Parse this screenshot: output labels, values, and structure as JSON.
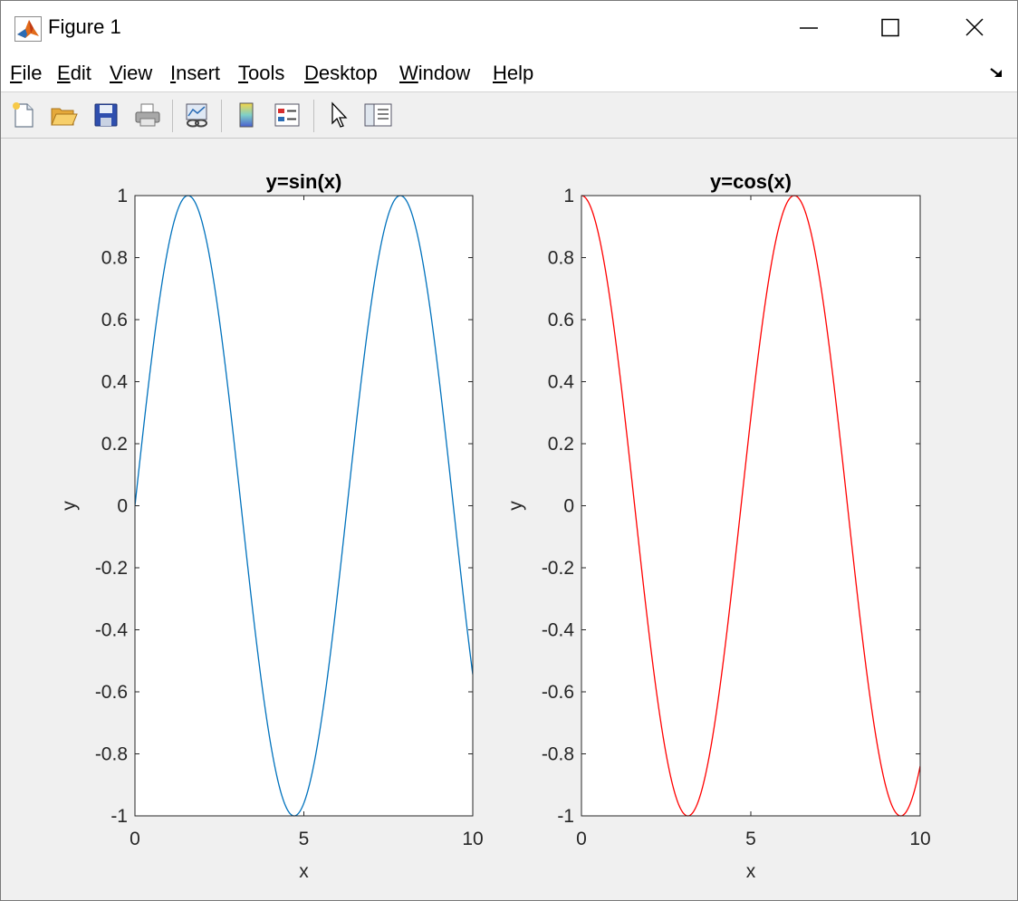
{
  "window": {
    "title": "Figure 1",
    "icons": {
      "app": "matlab-logo-icon",
      "minimize": "minimize-icon",
      "maximize": "maximize-icon",
      "close": "close-icon"
    }
  },
  "menubar": {
    "items": [
      {
        "label": "File",
        "accel": "F",
        "rest": "ile"
      },
      {
        "label": "Edit",
        "accel": "E",
        "rest": "dit"
      },
      {
        "label": "View",
        "accel": "V",
        "rest": "iew"
      },
      {
        "label": "Insert",
        "accel": "I",
        "rest": "nsert"
      },
      {
        "label": "Tools",
        "accel": "T",
        "rest": "ools"
      },
      {
        "label": "Desktop",
        "accel": "D",
        "rest": "esktop"
      },
      {
        "label": "Window",
        "accel": "W",
        "rest": "indow"
      },
      {
        "label": "Help",
        "accel": "H",
        "rest": "elp"
      }
    ],
    "dock_icon": "dock-arrow-icon"
  },
  "toolbar": {
    "buttons": [
      {
        "name": "new-figure",
        "icon": "new-file-icon"
      },
      {
        "name": "open-file",
        "icon": "folder-open-icon"
      },
      {
        "name": "save-figure",
        "icon": "floppy-disk-icon"
      },
      {
        "name": "print-figure",
        "icon": "printer-icon"
      },
      {
        "name": "link-plot",
        "icon": "link-plot-icon"
      },
      {
        "name": "insert-colorbar",
        "icon": "colorbar-icon"
      },
      {
        "name": "insert-legend",
        "icon": "legend-icon"
      },
      {
        "name": "edit-plot",
        "icon": "pointer-arrow-icon"
      },
      {
        "name": "show-plot-tools",
        "icon": "plot-tools-icon"
      }
    ]
  },
  "colors": {
    "sin_line": "#0072bd",
    "cos_line": "#ff0000",
    "axes_bg": "#ffffff",
    "figure_bg": "#f0f0f0",
    "axis_color": "#262626"
  },
  "chart_data": [
    {
      "type": "line",
      "title": "y=sin(x)",
      "xlabel": "x",
      "ylabel": "y",
      "xlim": [
        0,
        10
      ],
      "ylim": [
        -1,
        1
      ],
      "xticks": [
        0,
        5,
        10
      ],
      "xtick_labels": [
        "0",
        "5",
        "10"
      ],
      "yticks": [
        -1,
        -0.8,
        -0.6,
        -0.4,
        -0.2,
        0,
        0.2,
        0.4,
        0.6,
        0.8,
        1
      ],
      "ytick_labels": [
        "-1",
        "-0.8",
        "-0.6",
        "-0.4",
        "-0.2",
        "0",
        "0.2",
        "0.4",
        "0.6",
        "0.8",
        "1"
      ],
      "grid": false,
      "series": [
        {
          "color": "#0072bd",
          "x": [
            0,
            0.5,
            1,
            1.5,
            2,
            2.5,
            3,
            3.5,
            4,
            4.5,
            5,
            5.5,
            6,
            6.5,
            7,
            7.5,
            8,
            8.5,
            9,
            9.5,
            10
          ],
          "y": [
            0,
            0.479,
            0.841,
            0.997,
            0.909,
            0.598,
            0.141,
            -0.351,
            -0.757,
            -0.978,
            -0.959,
            -0.706,
            -0.279,
            0.215,
            0.657,
            0.938,
            0.989,
            0.798,
            0.412,
            -0.075,
            -0.544
          ]
        }
      ]
    },
    {
      "type": "line",
      "title": "y=cos(x)",
      "xlabel": "x",
      "ylabel": "y",
      "xlim": [
        0,
        10
      ],
      "ylim": [
        -1,
        1
      ],
      "xticks": [
        0,
        5,
        10
      ],
      "xtick_labels": [
        "0",
        "5",
        "10"
      ],
      "yticks": [
        -1,
        -0.8,
        -0.6,
        -0.4,
        -0.2,
        0,
        0.2,
        0.4,
        0.6,
        0.8,
        1
      ],
      "ytick_labels": [
        "-1",
        "-0.8",
        "-0.6",
        "-0.4",
        "-0.2",
        "0",
        "0.2",
        "0.4",
        "0.6",
        "0.8",
        "1"
      ],
      "grid": false,
      "series": [
        {
          "color": "#ff0000",
          "x": [
            0,
            0.5,
            1,
            1.5,
            2,
            2.5,
            3,
            3.5,
            4,
            4.5,
            5,
            5.5,
            6,
            6.5,
            7,
            7.5,
            8,
            8.5,
            9,
            9.5,
            10
          ],
          "y": [
            1,
            0.878,
            0.54,
            0.071,
            -0.416,
            -0.801,
            -0.99,
            -0.936,
            -0.654,
            -0.211,
            0.284,
            0.709,
            0.96,
            0.977,
            0.754,
            0.347,
            -0.146,
            -0.602,
            -0.911,
            -0.997,
            -0.839
          ]
        }
      ]
    }
  ]
}
